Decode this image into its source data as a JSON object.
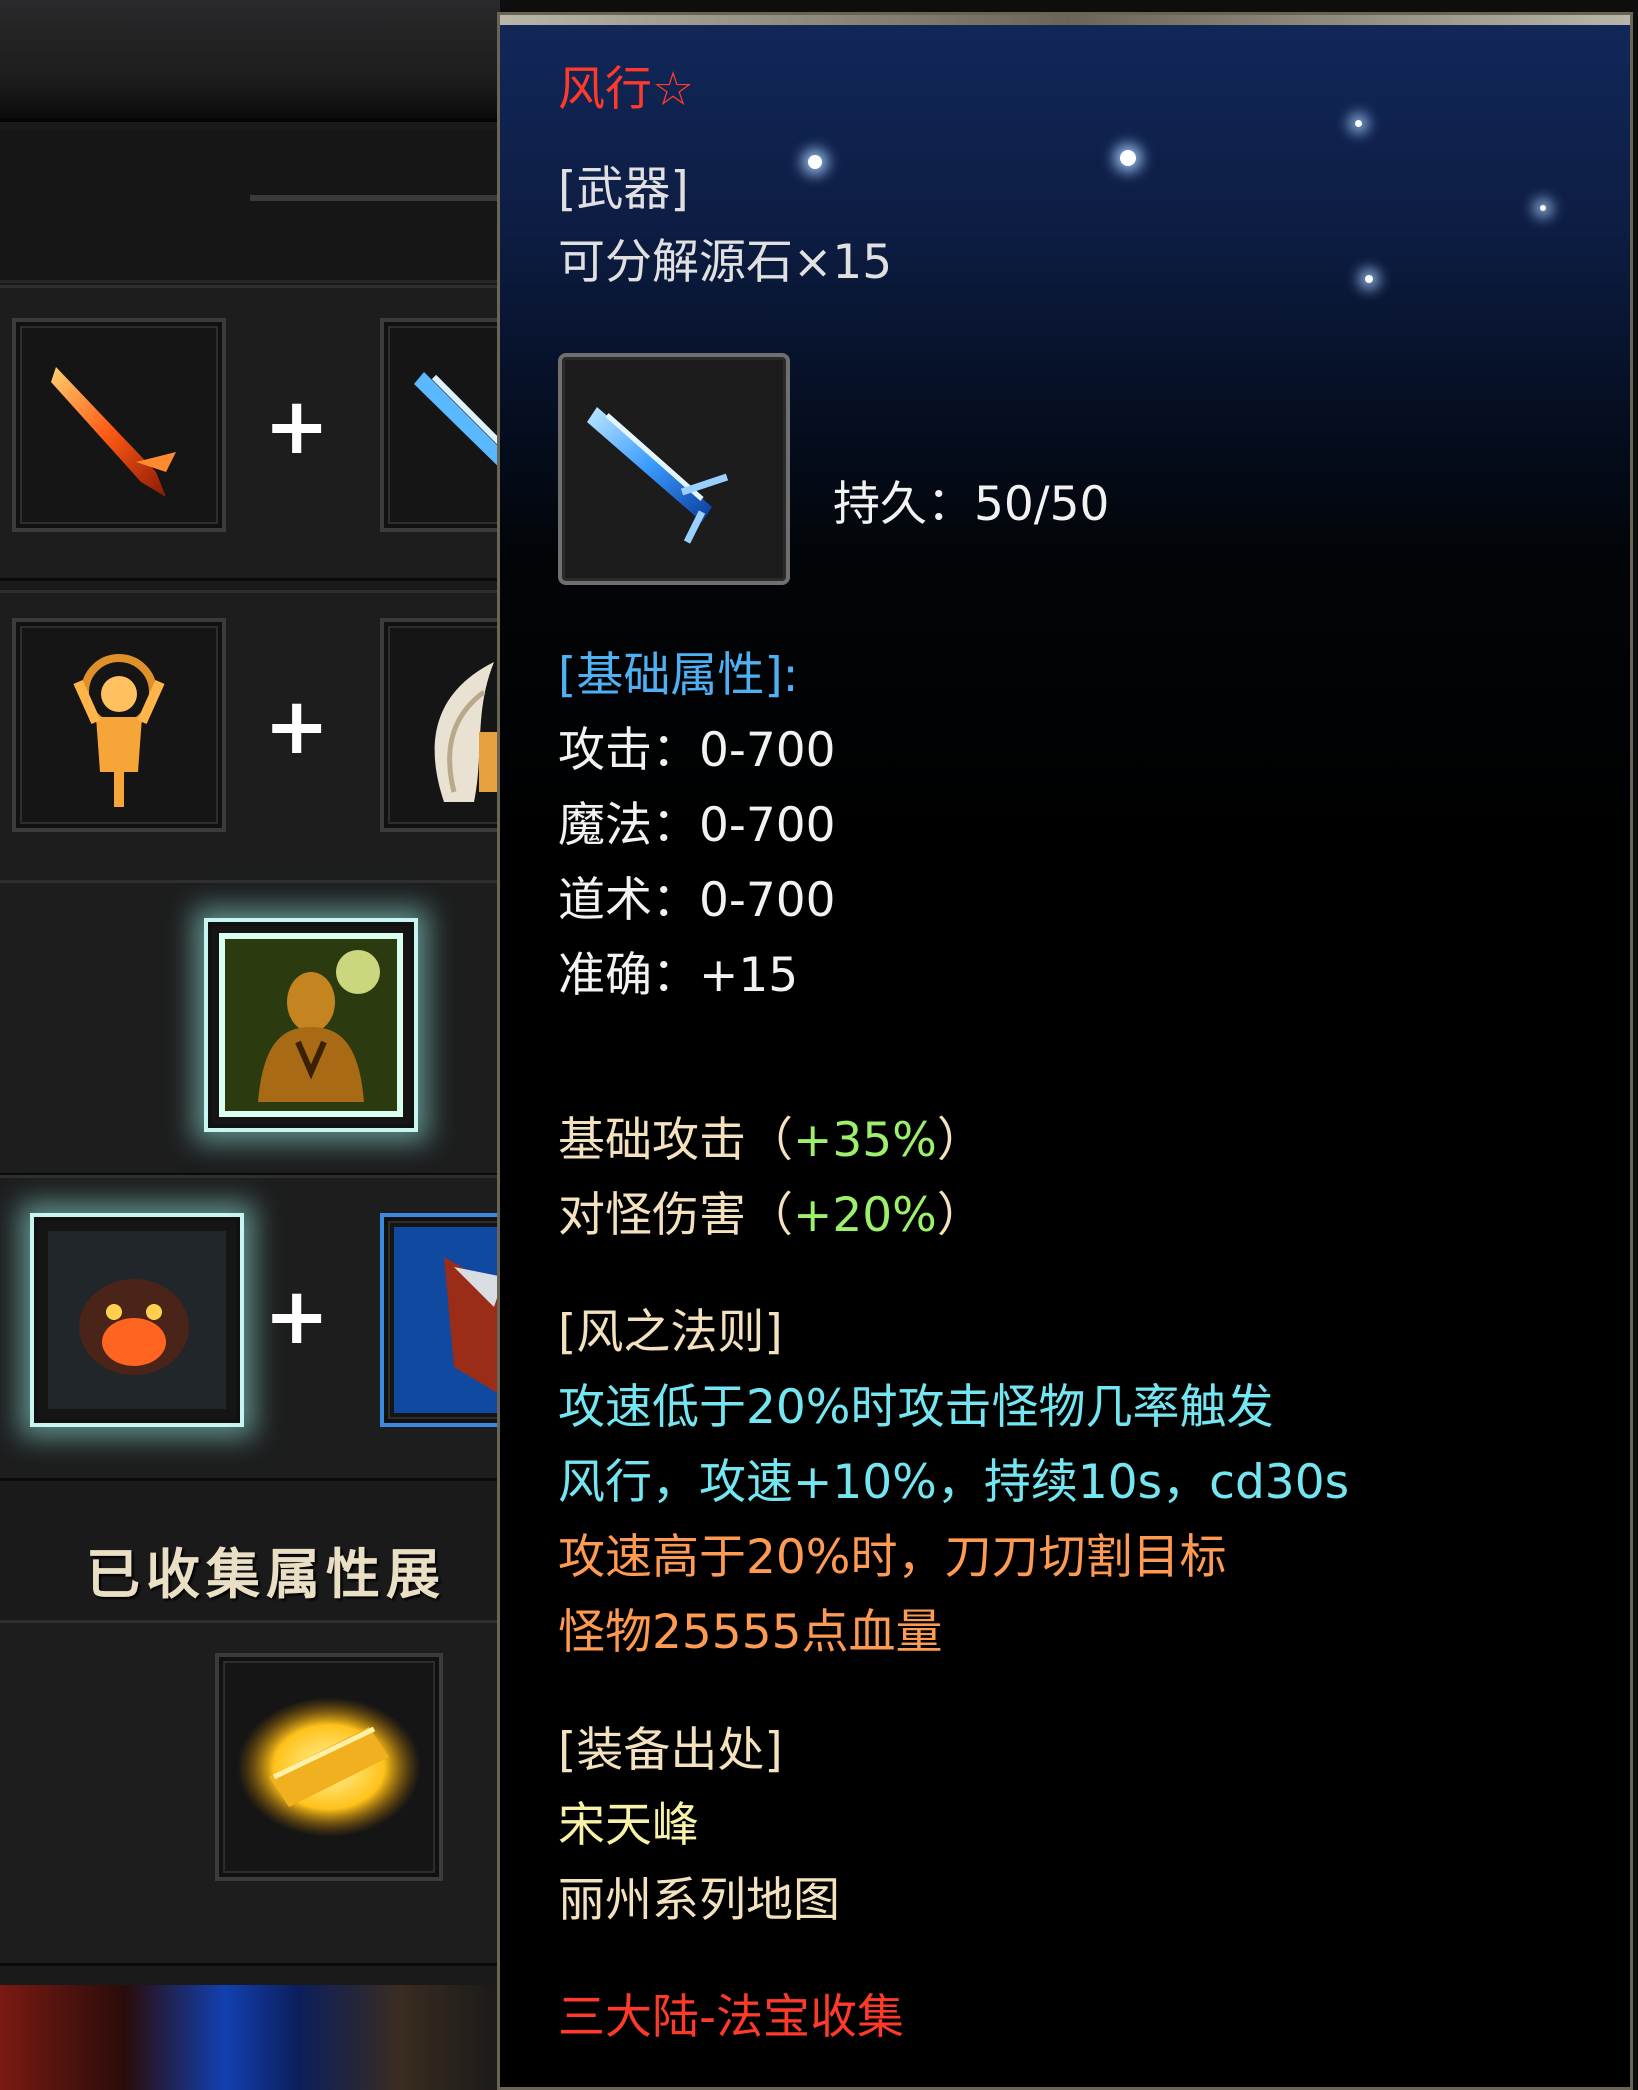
{
  "left": {
    "collected_title": "已收集属性展"
  },
  "tooltip": {
    "name": "风行☆",
    "category": "[武器]",
    "decompose": "可分解源石×15",
    "durability_label": "持久：",
    "durability_value": "50/50",
    "base_header": "[基础属性]:",
    "base_stats": [
      {
        "label": "攻击：",
        "value": "0-700"
      },
      {
        "label": "魔法：",
        "value": "0-700"
      },
      {
        "label": "道术：",
        "value": "0-700"
      },
      {
        "label": "准确：",
        "value": "+15"
      }
    ],
    "bonuses": [
      {
        "label": "基础攻击",
        "open": "（",
        "value": "+35%",
        "close": "）"
      },
      {
        "label": "对怪伤害",
        "open": "（",
        "value": "+20%",
        "close": "）"
      }
    ],
    "skill_header": "[风之法则]",
    "skill_lines_cyan": [
      "攻速低于20%时攻击怪物几率触发",
      "风行，攻速+10%，持续10s，cd30s"
    ],
    "skill_lines_orange": [
      "攻速高于20%时，刀刀切割目标",
      "怪物25555点血量"
    ],
    "source_header": "[装备出处]",
    "source_boss": "宋天峰",
    "source_map": "丽州系列地图",
    "footer": "三大陆-法宝收集"
  },
  "colors": {
    "name_red": "#ff3a2a",
    "header_blue": "#4fb0f4",
    "bonus_green": "#9cf06c",
    "skill_cyan": "#74e6f2",
    "skill_orange": "#ff9a52",
    "boss_yellow": "#f8f1a8"
  },
  "icons": [
    "red-sword-icon",
    "blue-sword-icon",
    "golden-figure-icon",
    "angel-wing-icon",
    "meditating-monk-icon",
    "fire-beast-icon",
    "blue-armor-icon",
    "golden-scroll-icon",
    "wind-blade-icon"
  ]
}
